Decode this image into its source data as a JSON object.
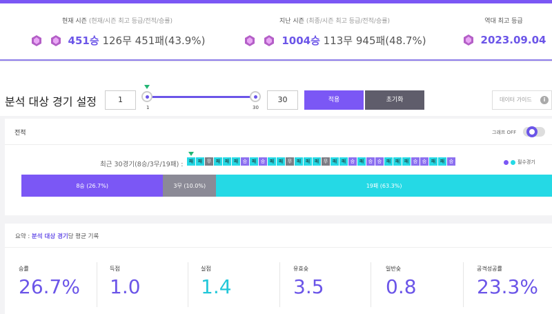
{
  "seasons": [
    {
      "label_main": "현재 시즌",
      "label_sub": "(현재/시즌 최고 등급/전적/승률)",
      "wins": "451승",
      "rest": "126무 451패(43.9%)"
    },
    {
      "label_main": "지난 시즌",
      "label_sub": "(최종/시즌 최고 등급/전적/승률)",
      "wins": "1004승",
      "rest": "113무 945패(48.7%)"
    },
    {
      "label_main": "역대 최고 등급",
      "value": "2023.09.04"
    }
  ],
  "settings": {
    "title": "분석 대상 경기 설정",
    "min_value": "1",
    "max_value": "30",
    "tick_min": "1",
    "tick_max": "30",
    "apply_label": "적용",
    "reset_label": "초기화",
    "guide_label": "데이터 가이드",
    "guide_icon": "i"
  },
  "record": {
    "title": "전적",
    "toggle_label": "그래프 OFF",
    "recent_label": "최근 30경기(8승/3무/19패) :",
    "games": [
      "패",
      "패",
      "무",
      "패",
      "패",
      "패",
      "승",
      "패",
      "승",
      "패",
      "패",
      "무",
      "패",
      "패",
      "패",
      "무",
      "패",
      "패",
      "승",
      "패",
      "승",
      "승",
      "패",
      "패",
      "패",
      "승",
      "승",
      "패",
      "패",
      "승"
    ],
    "must_legend": "필수경기",
    "bar": [
      {
        "label": "8승 (26.7%)",
        "share": 26.7
      },
      {
        "label": "3무 (10.0%)",
        "share": 10.0
      },
      {
        "label": "19패 (63.3%)",
        "share": 63.3
      }
    ]
  },
  "summary": {
    "prefix": "요약 : ",
    "highlight": "분석 대상 경기",
    "suffix": "당 평균 기록",
    "stats": [
      {
        "label": "승률",
        "value": "26.7%"
      },
      {
        "label": "득점",
        "value": "1.0"
      },
      {
        "label": "실점",
        "value": "1.4"
      },
      {
        "label": "유효슛",
        "value": "3.5"
      },
      {
        "label": "일반슛",
        "value": "0.8"
      },
      {
        "label": "공격성공률",
        "value": "23.3%"
      }
    ]
  },
  "colors": {
    "accent": "#7b57f5",
    "win": "#8b6ff0",
    "draw": "#7c7c84",
    "loss": "#25d9e5"
  }
}
